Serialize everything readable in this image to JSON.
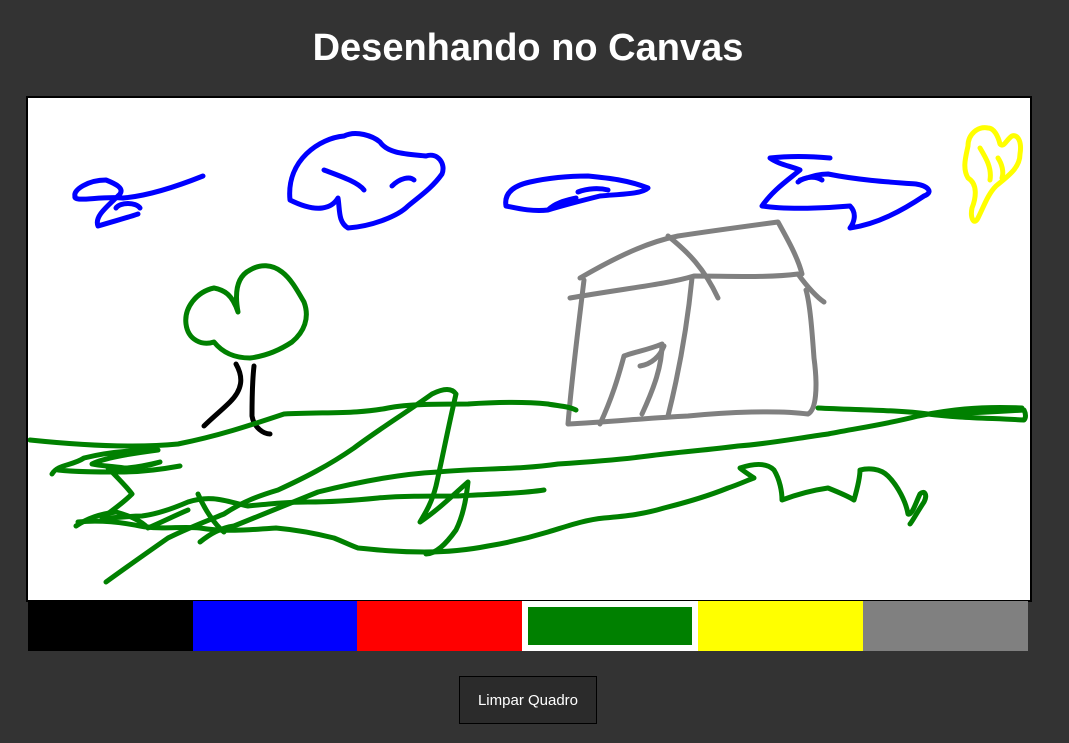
{
  "page": {
    "title": "Desenhando no Canvas"
  },
  "palette": {
    "colors": [
      {
        "name": "black",
        "hex": "#000000",
        "selected": false
      },
      {
        "name": "blue",
        "hex": "#0000ff",
        "selected": false
      },
      {
        "name": "red",
        "hex": "#ff0000",
        "selected": false
      },
      {
        "name": "green",
        "hex": "#008000",
        "selected": true
      },
      {
        "name": "yellow",
        "hex": "#ffff00",
        "selected": false
      },
      {
        "name": "gray",
        "hex": "#808080",
        "selected": false
      }
    ]
  },
  "buttons": {
    "clear_label": "Limpar Quadro"
  }
}
